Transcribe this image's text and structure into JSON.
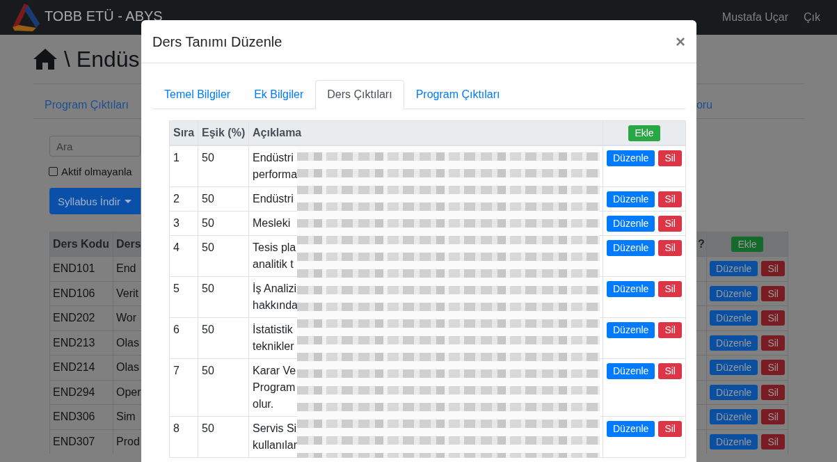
{
  "navbar": {
    "brand": "TOBB ETÜ - ABYS",
    "links": [
      "Mustafa Uçar",
      "Çık"
    ]
  },
  "page": {
    "title": "\\ Endüs",
    "tabs": [
      {
        "label": "Program Çıktıları",
        "selected": false
      },
      {
        "label": "oru",
        "selected": false
      }
    ],
    "search": {
      "placeholder": "Ara"
    },
    "inactive_filter": {
      "label": "Aktif olmayanla",
      "checked": false
    },
    "download_button": {
      "label": "Syllabus İndir"
    },
    "table": {
      "columns": [
        "Ders Kodu",
        "Ders"
      ],
      "right_columns": [
        "?"
      ],
      "add_button": "Ekle",
      "rows": [
        {
          "code": "END101",
          "name": "End",
          "edit": "Düzenle",
          "delete": "Sil"
        },
        {
          "code": "END106",
          "name": "Verit",
          "edit": "Düzenle",
          "delete": "Sil"
        },
        {
          "code": "END202",
          "name": "Wor",
          "edit": "Düzenle",
          "delete": "Sil"
        },
        {
          "code": "END213",
          "name": "Olas",
          "edit": "Düzenle",
          "delete": "Sil"
        },
        {
          "code": "END214",
          "name": "Olas",
          "edit": "Düzenle",
          "delete": "Sil"
        },
        {
          "code": "END294",
          "name": "Oper",
          "edit": "Düzenle",
          "delete": "Sil"
        },
        {
          "code": "END306",
          "name": "Sim",
          "edit": "Düzenle",
          "delete": "Sil"
        },
        {
          "code": "END307",
          "name": "Prod",
          "edit": "Düzenle",
          "delete": "Sil"
        }
      ]
    }
  },
  "modal": {
    "title": "Ders Tanımı Düzenle",
    "close": "×",
    "tabs": [
      {
        "label": "Temel Bilgiler",
        "selected": false
      },
      {
        "label": "Ek Bilgiler",
        "selected": false
      },
      {
        "label": "Ders Çıktıları",
        "selected": true
      },
      {
        "label": "Program Çıktıları",
        "selected": false
      }
    ],
    "table": {
      "columns": [
        "Sıra",
        "Eşik (%)",
        "Açıklama"
      ],
      "add_button": "Ekle",
      "rows": [
        {
          "number": "1",
          "threshold": "50",
          "description": [
            "Endüstri",
            "performa"
          ],
          "edit": "Düzenle",
          "delete": "Sil"
        },
        {
          "number": "2",
          "threshold": "50",
          "description": [
            "Endüstri"
          ],
          "edit": "Düzenle",
          "delete": "Sil"
        },
        {
          "number": "3",
          "threshold": "50",
          "description": [
            "Mesleki"
          ],
          "edit": "Düzenle",
          "delete": "Sil"
        },
        {
          "number": "4",
          "threshold": "50",
          "description": [
            "Tesis pla",
            "analitik t"
          ],
          "edit": "Düzenle",
          "delete": "Sil"
        },
        {
          "number": "5",
          "threshold": "50",
          "description": [
            "İş Analizi",
            "hakkında"
          ],
          "edit": "Düzenle",
          "delete": "Sil"
        },
        {
          "number": "6",
          "threshold": "50",
          "description": [
            "İstatistik",
            "teknikler"
          ],
          "edit": "Düzenle",
          "delete": "Sil"
        },
        {
          "number": "7",
          "threshold": "50",
          "description": [
            "Karar Ve",
            "Program",
            "olur."
          ],
          "edit": "Düzenle",
          "delete": "Sil"
        },
        {
          "number": "8",
          "threshold": "50",
          "description": [
            "Servis Si",
            "kullanılar"
          ],
          "edit": "Düzenle",
          "delete": "Sil"
        }
      ]
    }
  }
}
